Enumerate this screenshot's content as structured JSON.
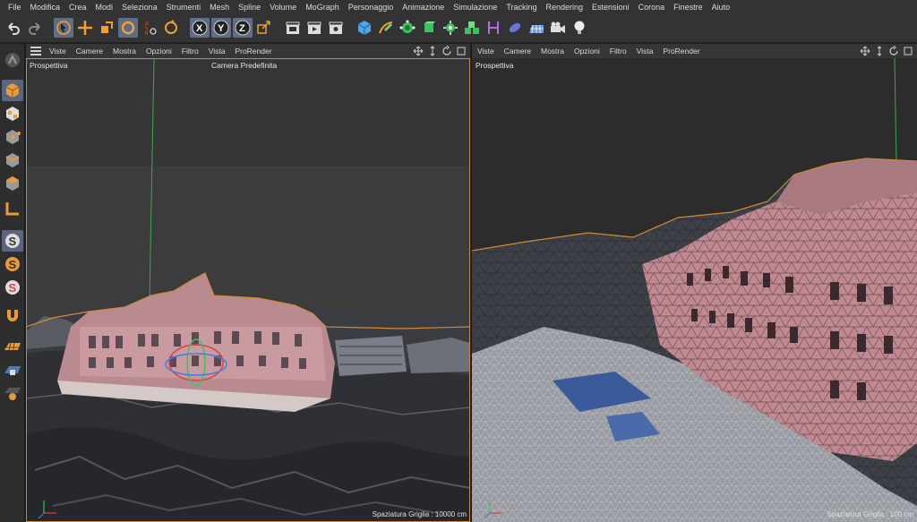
{
  "menubar": {
    "items": [
      "File",
      "Modifica",
      "Crea",
      "Modi",
      "Seleziona",
      "Strumenti",
      "Mesh",
      "Spline",
      "Volume",
      "MoGraph",
      "Personaggio",
      "Animazione",
      "Simulazione",
      "Tracking",
      "Rendering",
      "Estensioni",
      "Corona",
      "Finestre",
      "Aiuto"
    ]
  },
  "toolbar": {
    "tools": [
      {
        "icon": "undo-icon"
      },
      {
        "icon": "redo-icon"
      },
      {
        "icon": "select-live-icon",
        "active": true
      },
      {
        "icon": "move-icon"
      },
      {
        "icon": "scale-icon"
      },
      {
        "icon": "rotate-icon",
        "active": true
      },
      {
        "icon": "psr-icon"
      },
      {
        "icon": "recent-tool-icon"
      },
      {
        "icon": "axis-x-icon",
        "active": true
      },
      {
        "icon": "axis-y-icon",
        "active": true
      },
      {
        "icon": "axis-z-icon",
        "active": true
      },
      {
        "icon": "coordinate-system-icon"
      },
      {
        "icon": "render-region-icon"
      },
      {
        "icon": "render-view-icon"
      },
      {
        "icon": "render-settings-icon"
      },
      {
        "icon": "cube-icon"
      },
      {
        "icon": "pen-spline-icon"
      },
      {
        "icon": "subdivision-icon"
      },
      {
        "icon": "extrude-icon"
      },
      {
        "icon": "cloner-icon"
      },
      {
        "icon": "mograph-icon"
      },
      {
        "icon": "bend-deformer-icon"
      },
      {
        "icon": "field-icon"
      },
      {
        "icon": "floor-icon"
      },
      {
        "icon": "camera-icon"
      },
      {
        "icon": "light-icon"
      }
    ],
    "x_label": "X",
    "y_label": "Y",
    "z_label": "Z"
  },
  "palette": {
    "tools": [
      "make-editable-icon",
      "model-mode-icon",
      "texture-mode-icon",
      "points-mode-icon",
      "edges-mode-icon",
      "polygons-mode-icon",
      "axis-mode-icon",
      "snap-icon",
      "snap-settings-icon",
      "workplane-icon",
      "magnet-icon",
      "grid-icon",
      "lock-grid-icon",
      "symmetry-icon"
    ]
  },
  "viewport_menu": [
    "Viste",
    "Camere",
    "Mostra",
    "Opzioni",
    "Filtro",
    "Vista",
    "ProRender"
  ],
  "viewports": {
    "left": {
      "label": "Prospettiva",
      "camera": "Camera Predefinita",
      "grid": "Spaziatura Griglia : 10000 cm"
    },
    "right": {
      "label": "Prospettiva",
      "grid": "Spaziatura Griglia : 100 cm"
    }
  },
  "colors": {
    "chrome": "#333333",
    "active_tool": "#5f6d86",
    "viewport_bg": "#2f2f2f",
    "highlight_border": "#c88a3c",
    "building": "#c88f95",
    "ground": "#3b3d44"
  }
}
